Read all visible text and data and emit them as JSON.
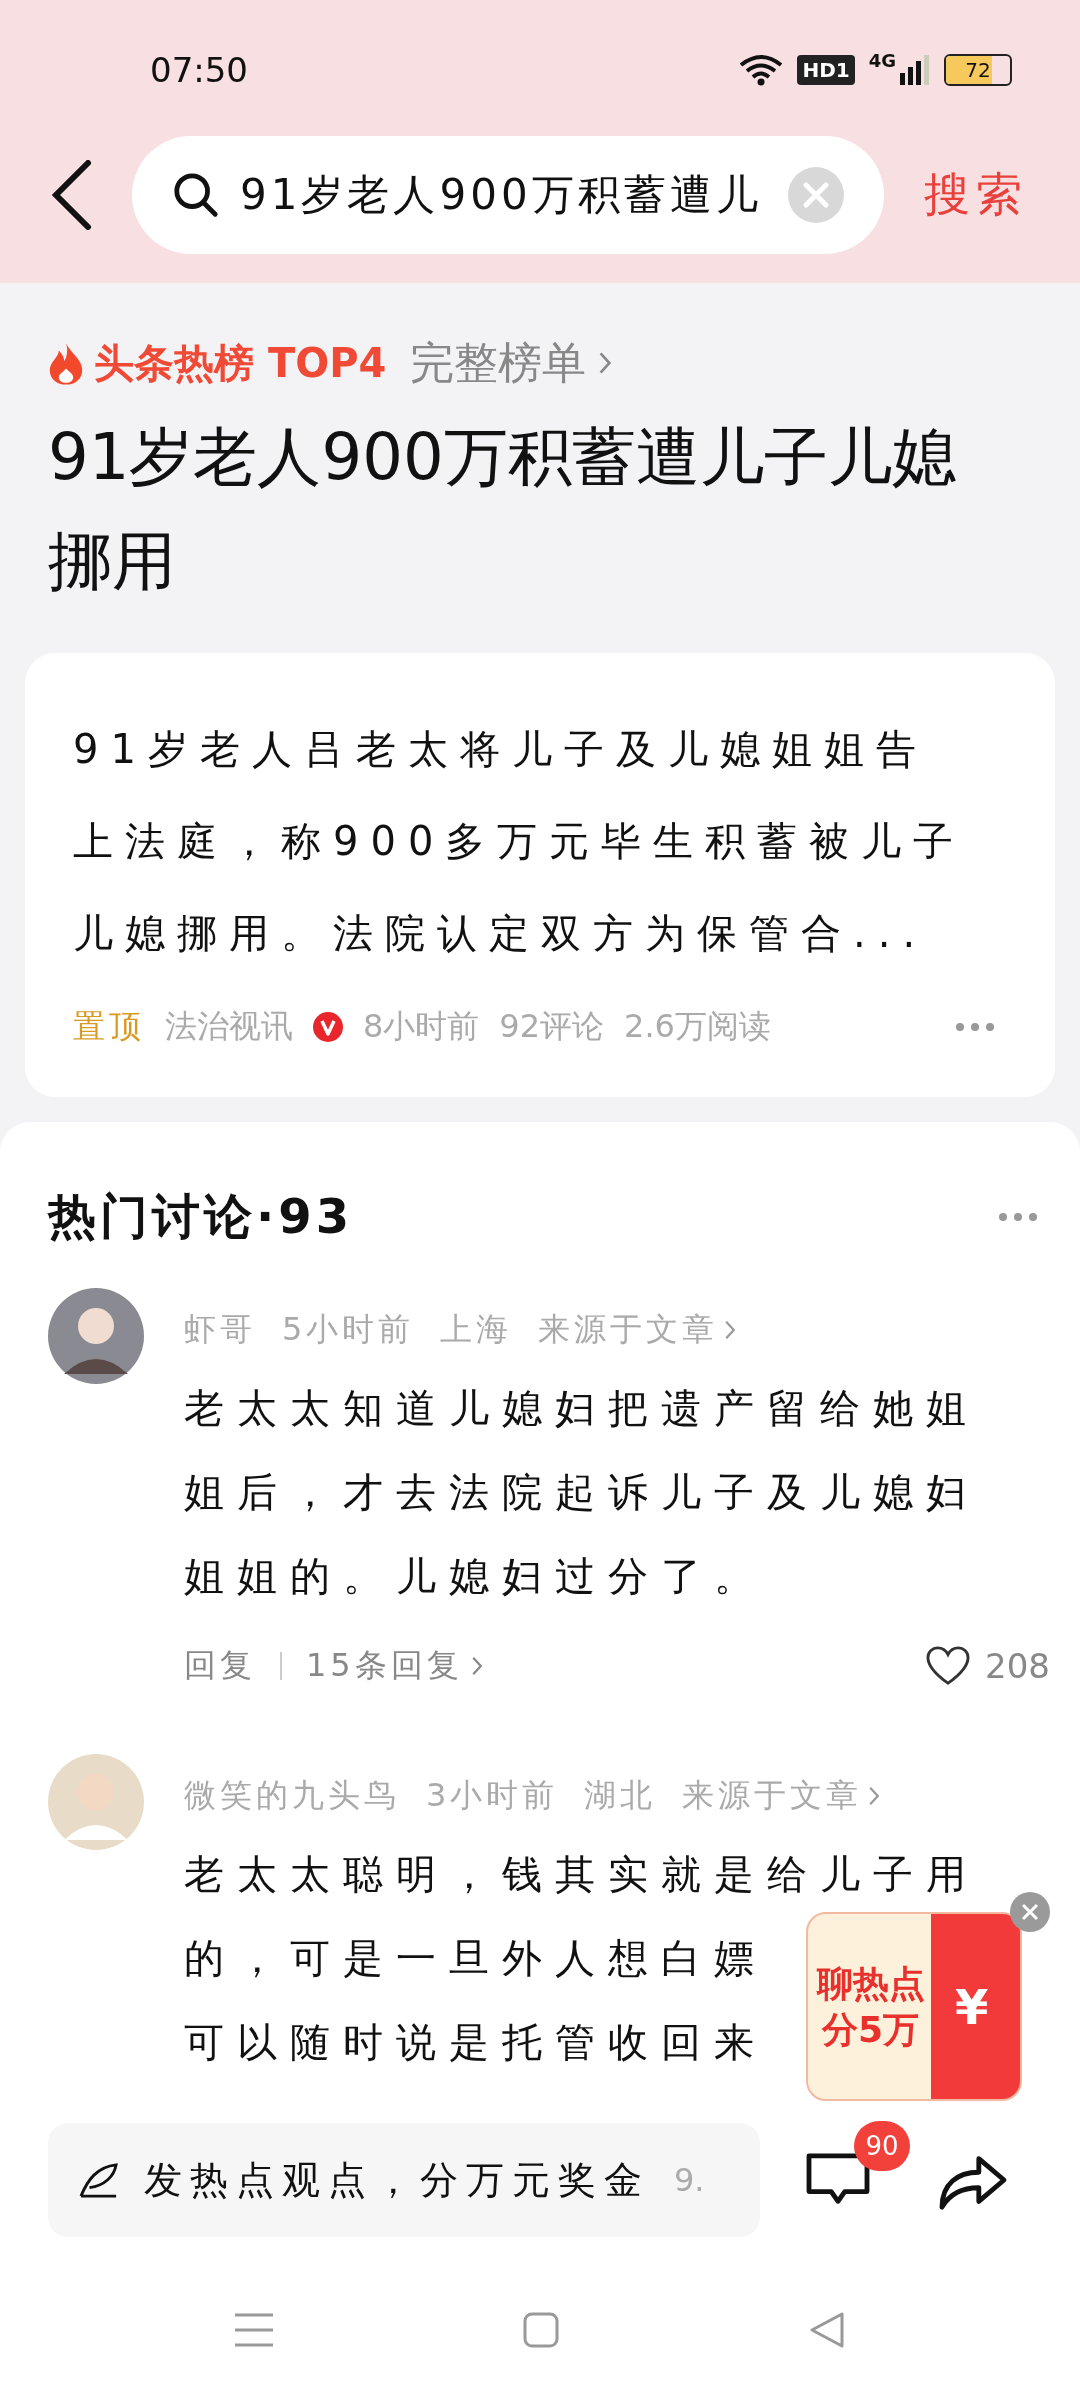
{
  "status_bar": {
    "time": "07:50",
    "hd_badge": "HD1",
    "network": "4G",
    "battery": "72"
  },
  "search": {
    "value": "91岁老人900万积蓄遭儿",
    "submit": "搜索"
  },
  "hot_label": {
    "rank": "头条热榜 TOP4",
    "link": "完整榜单"
  },
  "headline": "91岁老人900万积蓄遭儿子儿媳挪用",
  "article": {
    "summary": "91岁老人吕老太将儿子及儿媳姐姐告上法庭，称900多万元毕生积蓄被儿子儿媳挪用。法院认定双方为保管合...",
    "pinned": "置顶",
    "source": "法治视讯",
    "verified": true,
    "time": "8小时前",
    "comments": "92评论",
    "reads": "2.6万阅读"
  },
  "discussion": {
    "title": "热门讨论·93",
    "comments": [
      {
        "user": "虾哥",
        "time": "5小时前",
        "location": "上海",
        "source": "来源于文章",
        "texts": [
          "老太太知道儿媳妇把遗产留给她姐姐后，才去法院起诉儿子及儿媳妇姐姐的。儿媳妇过分了。"
        ],
        "reply": "回复",
        "replies": "15条回复",
        "likes": "208",
        "liked": false
      },
      {
        "user": "微笑的九头鸟",
        "time": "3小时前",
        "location": "湖北",
        "source": "来源于文章",
        "texts": [
          "老太太聪明，钱其实就是给儿子用",
          "的，可是一旦外人想白嫖",
          "可以随时说是托管收回来"
        ]
      }
    ]
  },
  "promo": {
    "line_1": "聊热点",
    "line_2": "分5万",
    "symbol": "¥"
  },
  "bottom_bar": {
    "placeholder": "发热点观点，分万元奖金",
    "placeholder_tail": "9.",
    "comment_count": "90"
  }
}
